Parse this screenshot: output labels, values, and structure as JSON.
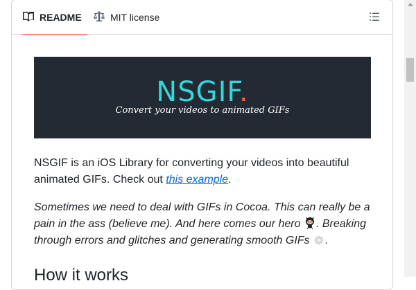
{
  "tabs": {
    "readme_label": "README",
    "license_label": "MIT license"
  },
  "banner": {
    "title": "NSGIF",
    "title_dot": ".",
    "subtitle": "Convert your videos to animated GIFs"
  },
  "content": {
    "intro_text": "NSGIF is an iOS Library for converting your videos into beautiful animated GIFs. Check out ",
    "intro_link": "this example",
    "intro_end": ".",
    "note_part1": "Sometimes we need to deal with GIFs in Cocoa. This can really be a pain in the ass (believe me). And here comes our hero ",
    "note_part2": ". Breaking through errors and glitches and generating smooth GIFs ",
    "note_end": ".",
    "heading": "How it works"
  },
  "colors": {
    "accent_underline": "#fd8c73",
    "link": "#0969da",
    "banner_bg": "#242a33",
    "banner_title": "#33d6d9",
    "banner_dot": "#ff5d36"
  },
  "icons": {
    "readme_tab": "book-icon",
    "license_tab": "law-scale-icon",
    "toc": "list-unordered-icon",
    "hero": "octocat-icon",
    "smooth": "gear-emoji-icon"
  }
}
